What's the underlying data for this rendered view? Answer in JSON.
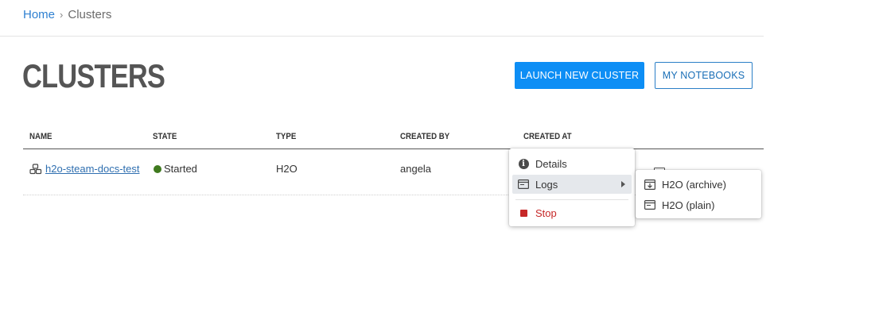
{
  "breadcrumb": {
    "home": "Home",
    "separator": "›",
    "current": "Clusters"
  },
  "page": {
    "title": "CLUSTERS"
  },
  "buttons": {
    "launch": "LAUNCH NEW CLUSTER",
    "notebooks": "MY NOTEBOOKS"
  },
  "table": {
    "columns": [
      "NAME",
      "STATE",
      "TYPE",
      "CREATED BY",
      "CREATED AT"
    ],
    "rows": [
      {
        "name": "h2o-steam-docs-test",
        "state": "Started",
        "type": "H2O",
        "created_by": "angela"
      }
    ]
  },
  "context_menu": {
    "items": [
      {
        "label": "Details",
        "icon": "info-circle-icon"
      },
      {
        "label": "Logs",
        "icon": "log-window-icon",
        "submenu": true
      },
      {
        "label": "Stop",
        "icon": "stop-icon"
      }
    ],
    "logs_submenu": [
      {
        "label": "H2O (archive)",
        "icon": "archive-download-icon"
      },
      {
        "label": "H2O (plain)",
        "icon": "log-window-icon"
      }
    ]
  },
  "colors": {
    "accent": "#0d8ef5",
    "link": "#2f6fb0",
    "started": "#3f7a1e",
    "stop": "#c62828"
  }
}
